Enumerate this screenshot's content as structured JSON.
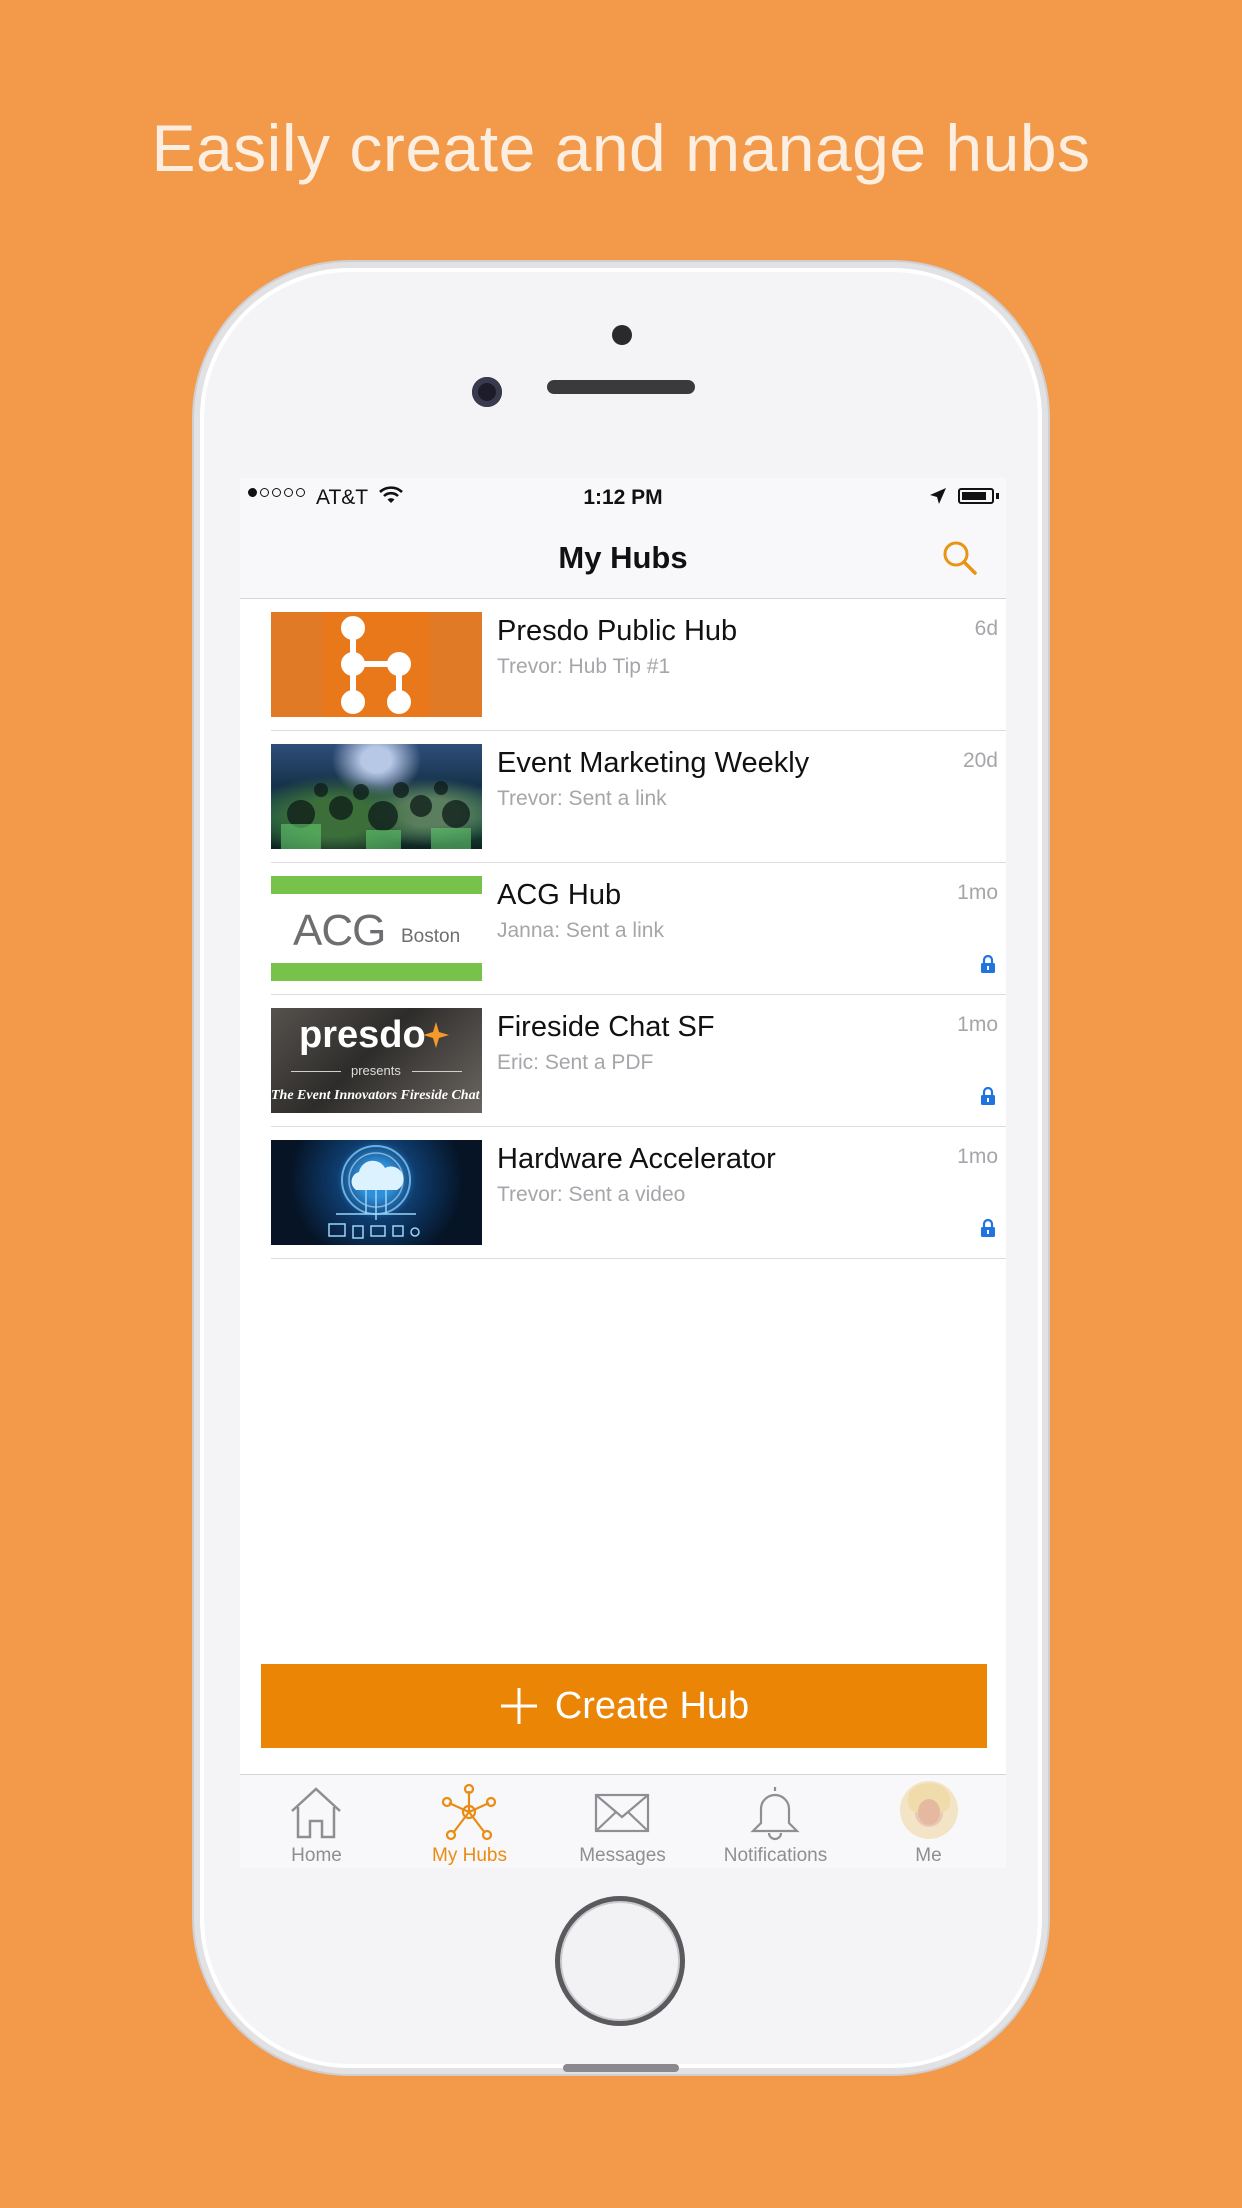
{
  "headline": "Easily create and manage hubs",
  "status_bar": {
    "carrier": "AT&T",
    "time": "1:12 PM"
  },
  "nav": {
    "title": "My Hubs",
    "search_icon": "search-icon"
  },
  "hubs": [
    {
      "name": "Presdo Public Hub",
      "subtitle": "Trevor: Hub Tip #1",
      "time": "6d",
      "locked": false,
      "thumb": "presdo-logo"
    },
    {
      "name": "Event Marketing Weekly",
      "subtitle": "Trevor: Sent a link",
      "time": "20d",
      "locked": false,
      "thumb": "crowd-photo"
    },
    {
      "name": "ACG Hub",
      "subtitle": "Janna: Sent a link",
      "time": "1mo",
      "locked": true,
      "thumb": "acg-boston-logo",
      "thumb_text": {
        "main": "ACG",
        "sub": "Boston"
      }
    },
    {
      "name": "Fireside Chat SF",
      "subtitle": "Eric: Sent a PDF",
      "time": "1mo",
      "locked": true,
      "thumb": "presdo-presents",
      "thumb_text": {
        "main": "presdo",
        "mid": "presents",
        "sub": "The Event Innovators Fireside Chat"
      }
    },
    {
      "name": "Hardware Accelerator",
      "subtitle": "Trevor: Sent a video",
      "time": "1mo",
      "locked": true,
      "thumb": "cloud-network"
    }
  ],
  "create_button": {
    "label": "Create Hub",
    "icon": "plus-icon"
  },
  "tabs": [
    {
      "label": "Home",
      "icon": "home-icon",
      "active": false
    },
    {
      "label": "My Hubs",
      "icon": "hub-network-icon",
      "active": true
    },
    {
      "label": "Messages",
      "icon": "envelope-icon",
      "active": false
    },
    {
      "label": "Notifications",
      "icon": "bell-icon",
      "active": false
    },
    {
      "label": "Me",
      "icon": "avatar",
      "active": false
    }
  ],
  "colors": {
    "background": "#F29A4A",
    "accent": "#EA8505",
    "lock": "#1F74E0"
  }
}
